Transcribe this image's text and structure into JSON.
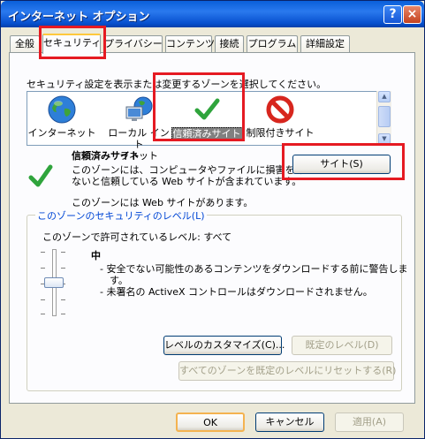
{
  "window": {
    "title": "インターネット オプション",
    "help_glyph": "?",
    "close_glyph": "×"
  },
  "tabs": [
    "全般",
    "セキュリティ",
    "プライバシー",
    "コンテンツ",
    "接続",
    "プログラム",
    "詳細設定"
  ],
  "security": {
    "instruction": "セキュリティ設定を表示または変更するゾーンを選択してください。",
    "zones": [
      {
        "icon": "globe-icon",
        "label": "インターネット"
      },
      {
        "icon": "local-intranet-icon",
        "label_lines": [
          "ローカル イント",
          "ラネット"
        ]
      },
      {
        "icon": "checkmark-icon",
        "label": "信頼済みサイト",
        "selected": true
      },
      {
        "icon": "restricted-icon",
        "label": "制限付きサイト"
      }
    ],
    "zone_name": "信頼済みサイト",
    "zone_desc_lines": [
      "このゾーンには、コンピュータやファイルに損害を与え",
      "ないと信頼している Web サイトが含まれています。"
    ],
    "zone_has_sites": "このゾーンには Web サイトがあります。",
    "sites_button": "サイト(S)",
    "level_group_title": "このゾーンのセキュリティのレベル(L)",
    "allowed_level": "このゾーンで許可されているレベル: すべて",
    "level_name": "中",
    "level_points_lines": [
      "- 安全でない可能性のあるコンテンツをダウンロードする前に警告しま",
      "す。",
      "- 未署名の ActiveX コントロールはダウンロードされません。"
    ],
    "custom_level_button": "レベルのカスタマイズ(C)...",
    "default_level_button": "既定のレベル(D)",
    "reset_all_button": "すべてのゾーンを既定のレベルにリセットする(R)"
  },
  "footer": {
    "ok": "OK",
    "cancel": "キャンセル",
    "apply": "適用(A)"
  },
  "colors": {
    "highlight": "#E51A22",
    "xp_title": "#0A5FD9",
    "dialog_bg": "#ECE9D8"
  }
}
